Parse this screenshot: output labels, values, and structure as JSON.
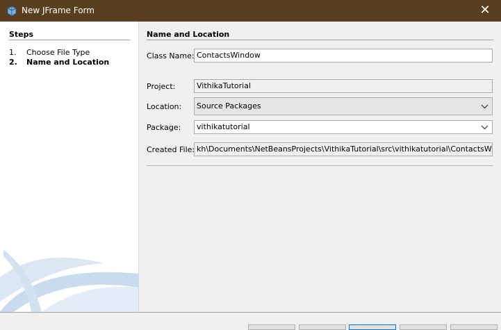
{
  "window": {
    "title": "New JFrame Form",
    "close_glyph": "✕"
  },
  "steps": {
    "heading": "Steps",
    "items": [
      {
        "num": "1.",
        "label": "Choose File Type"
      },
      {
        "num": "2.",
        "label": "Name and Location"
      }
    ]
  },
  "panel": {
    "heading": "Name and Location",
    "class_name": {
      "label": "Class Name:",
      "value": "ContactsWindow"
    },
    "project": {
      "label": "Project:",
      "value": "VithikaTutorial"
    },
    "location": {
      "label": "Location:",
      "value": "Source Packages"
    },
    "package": {
      "label": "Package:",
      "value": "vithikatutorial"
    },
    "created_file": {
      "label": "Created File:",
      "value": "kh\\Documents\\NetBeansProjects\\VithikaTutorial\\src\\vithikatutorial\\ContactsWindow.java"
    }
  },
  "colors": {
    "titlebar": "#5a3f1f",
    "accent": "#0078d7"
  }
}
